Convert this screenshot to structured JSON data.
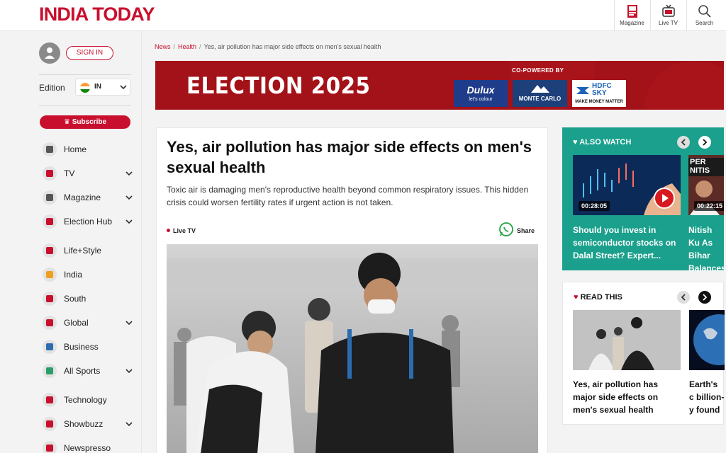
{
  "header": {
    "logo": "INDIA TODAY",
    "buttons": [
      {
        "label": "Magazine",
        "icon": "magazine-icon"
      },
      {
        "label": "Live TV",
        "icon": "tv-icon"
      },
      {
        "label": "Search",
        "icon": "search-icon"
      }
    ]
  },
  "sidebar": {
    "signin": "SIGN IN",
    "edition_label": "Edition",
    "edition_value": "IN",
    "subscribe": "Subscribe",
    "items": [
      {
        "label": "Home",
        "icon": "home-icon",
        "expandable": false
      },
      {
        "label": "TV",
        "icon": "live-tv-icon",
        "expandable": true
      },
      {
        "label": "Magazine",
        "icon": "magazine-icon",
        "expandable": true
      },
      {
        "label": "Election Hub",
        "icon": "election-icon",
        "expandable": true
      },
      {
        "label": "Life+Style",
        "icon": "lifestyle-icon",
        "expandable": false
      },
      {
        "label": "India",
        "icon": "india-icon",
        "expandable": false
      },
      {
        "label": "South",
        "icon": "temple-icon",
        "expandable": false
      },
      {
        "label": "Global",
        "icon": "globe-icon",
        "expandable": true
      },
      {
        "label": "Business",
        "icon": "business-chart-icon",
        "expandable": false
      },
      {
        "label": "All Sports",
        "icon": "sports-icon",
        "expandable": true
      },
      {
        "label": "Technology",
        "icon": "technology-icon",
        "expandable": false
      },
      {
        "label": "Showbuzz",
        "icon": "showbuzz-icon",
        "expandable": true
      },
      {
        "label": "Newspresso",
        "icon": "coffee-icon",
        "expandable": false
      }
    ]
  },
  "breadcrumb": {
    "news": "News",
    "health": "Health",
    "current": "Yes, air pollution has major side effects on men's sexual health"
  },
  "banner": {
    "title": "ELECTION 2025",
    "copowered": "CO-POWERED BY",
    "sponsors": [
      "Dulux",
      "let's colour",
      "MONTE CARLO",
      "HDFC SKY",
      "MAKE MONEY MATTER"
    ]
  },
  "article": {
    "title": "Yes, air pollution has major side effects on men's sexual health",
    "subtitle": "Toxic air is damaging men's reproductive health beyond common respiratory issues. This hidden crisis could worsen fertility rates if urgent action is not taken.",
    "live_tv": "Live TV",
    "share": "Share"
  },
  "also_watch": {
    "title": "ALSO WATCH",
    "videos": [
      {
        "duration": "00:28:05",
        "caption": "Should you invest in semiconductor stocks on Dalal Street? Expert..."
      },
      {
        "duration": "00:22:15",
        "caption": "Nitish Ku As Bihar Balances",
        "thumb_text": "PER NITIS"
      }
    ]
  },
  "read_this": {
    "title": "READ THIS",
    "items": [
      {
        "caption": "Yes, air pollution has major side effects on men's sexual health"
      },
      {
        "caption": "Earth's c billion-y found"
      }
    ]
  },
  "colors": {
    "brand_red": "#c8102e",
    "teal": "#1aa08c",
    "banner_red": "#a31218"
  }
}
